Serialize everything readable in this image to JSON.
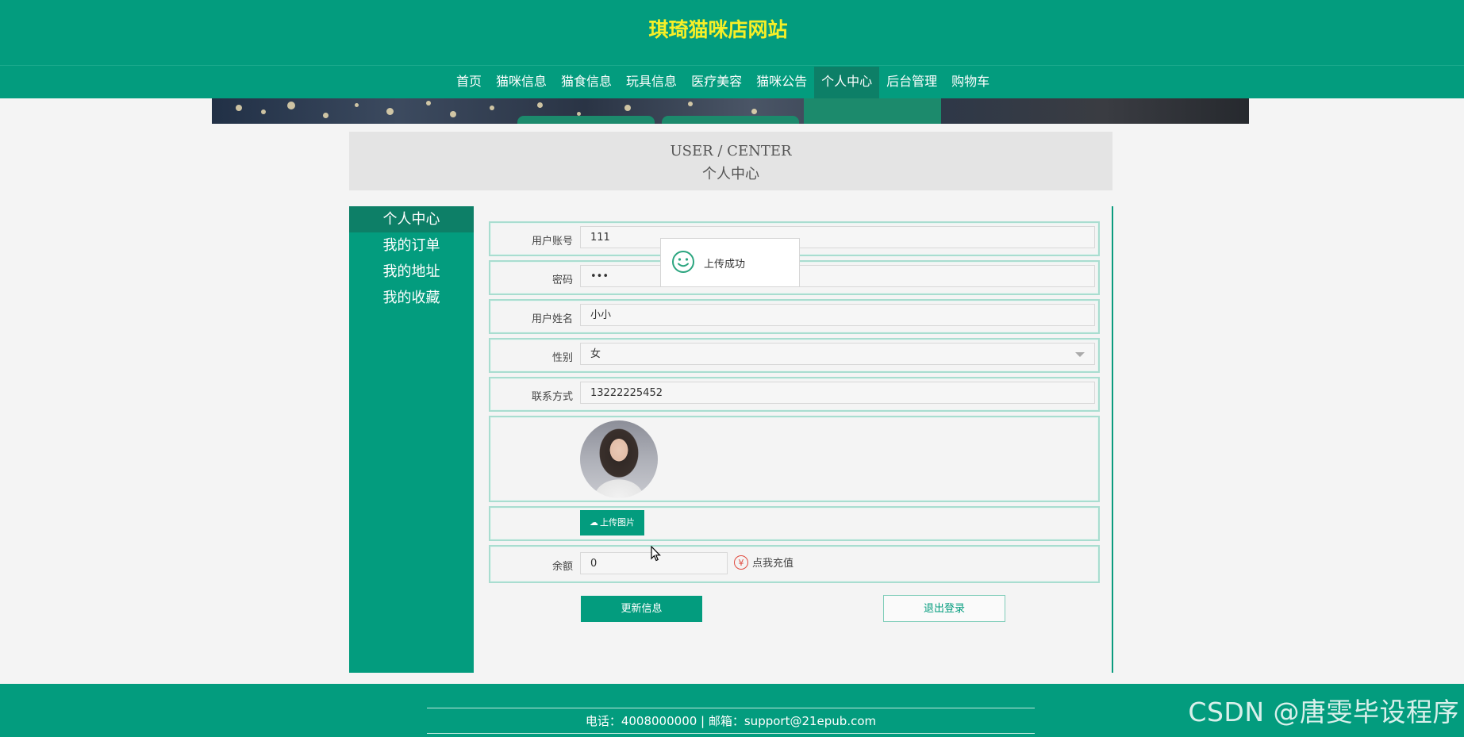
{
  "site": {
    "title": "琪琦猫咪店网站"
  },
  "nav": {
    "items": [
      {
        "label": "首页"
      },
      {
        "label": "猫咪信息"
      },
      {
        "label": "猫食信息"
      },
      {
        "label": "玩具信息"
      },
      {
        "label": "医疗美容"
      },
      {
        "label": "猫咪公告"
      },
      {
        "label": "个人中心",
        "active": true
      },
      {
        "label": "后台管理"
      },
      {
        "label": "购物车"
      }
    ]
  },
  "page_header": {
    "en": "USER / CENTER",
    "zh": "个人中心"
  },
  "sidebar": {
    "items": [
      {
        "label": "个人中心",
        "active": true
      },
      {
        "label": "我的订单"
      },
      {
        "label": "我的地址"
      },
      {
        "label": "我的收藏"
      }
    ]
  },
  "form": {
    "account": {
      "label": "用户账号",
      "value": "111"
    },
    "password": {
      "label": "密码",
      "value": "•••"
    },
    "name": {
      "label": "用户姓名",
      "value": "小小"
    },
    "gender": {
      "label": "性别",
      "value": "女"
    },
    "phone": {
      "label": "联系方式",
      "value": "13222225452"
    },
    "upload_button": "上传图片",
    "balance": {
      "label": "余额",
      "value": "0"
    },
    "recharge_label": "点我充值"
  },
  "buttons": {
    "update": "更新信息",
    "logout": "退出登录"
  },
  "toast": {
    "message": "上传成功",
    "icon": "smile-icon"
  },
  "footer": {
    "text": "电话：4008000000 | 邮箱：support@21epub.com"
  },
  "watermark": "CSDN @唐雯毕设程序",
  "colors": {
    "primary": "#039c7e",
    "active": "#0d7f67",
    "title": "#f6ef27"
  }
}
